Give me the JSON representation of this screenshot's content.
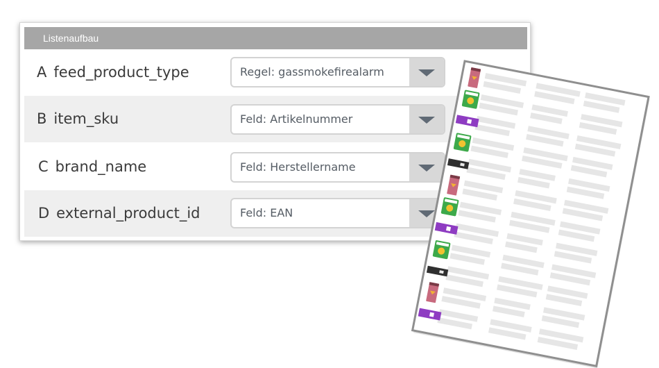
{
  "panel": {
    "title": "Listenaufbau",
    "rows": [
      {
        "letter": "A",
        "field": "feed_product_type",
        "value": "Regel: gassmokefirealarm"
      },
      {
        "letter": "B",
        "field": "item_sku",
        "value": "Feld: Artikelnummer"
      },
      {
        "letter": "C",
        "field": "brand_name",
        "value": "Feld: Herstellername"
      },
      {
        "letter": "D",
        "field": "external_product_id",
        "value": "Feld: EAN"
      }
    ]
  },
  "sheet": {
    "product_icons": [
      "coffee-bag-icon",
      "green-pouch-icon",
      "purple-box-icon",
      "green-pouch-icon",
      "black-box-icon",
      "coffee-bag-icon",
      "green-pouch-icon",
      "purple-box-icon",
      "green-pouch-icon",
      "black-box-icon",
      "coffee-bag-icon",
      "purple-box-icon"
    ],
    "colors": {
      "coffee-bag": "#c86a7e",
      "green-pouch": "#3da94a",
      "purple-box": "#8e3cc2",
      "black-box": "#2f2f2f",
      "placeholder": "#e6e6e6"
    }
  },
  "colors": {
    "header_bg": "#a6a6a6",
    "row_shade": "#efefef",
    "dropdown_button": "#d8d8d8"
  }
}
